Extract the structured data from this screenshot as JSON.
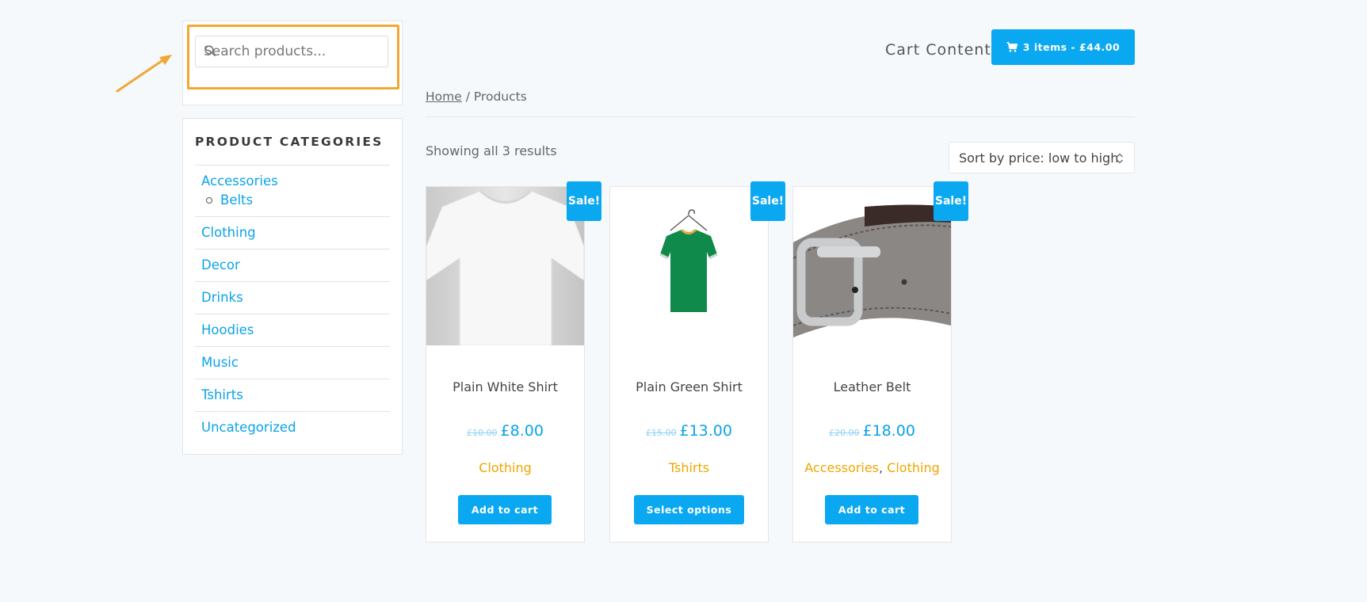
{
  "search": {
    "placeholder": "Search products..."
  },
  "sidebar": {
    "categories_title": "PRODUCT CATEGORIES",
    "categories": [
      {
        "label": "Accessories",
        "children": [
          {
            "label": "Belts"
          }
        ]
      },
      {
        "label": "Clothing"
      },
      {
        "label": "Decor"
      },
      {
        "label": "Drinks"
      },
      {
        "label": "Hoodies"
      },
      {
        "label": "Music"
      },
      {
        "label": "Tshirts"
      },
      {
        "label": "Uncategorized"
      }
    ]
  },
  "header": {
    "cart_label": "Cart Content:",
    "cart_button": "3 items - £44.00"
  },
  "breadcrumb": {
    "home": "Home",
    "separator": " / ",
    "current": "Products"
  },
  "results_text": "Showing all 3 results",
  "sort": {
    "selected": "Sort by price: low to high"
  },
  "products": [
    {
      "name": "Plain White Shirt",
      "old_price": "£10.00",
      "price": "£8.00",
      "categories": [
        "Clothing"
      ],
      "button": "Add to cart",
      "badge": "Sale!"
    },
    {
      "name": "Plain Green Shirt",
      "old_price": "£15.00",
      "price": "£13.00",
      "categories": [
        "Tshirts"
      ],
      "button": "Select options",
      "badge": "Sale!"
    },
    {
      "name": "Leather Belt",
      "old_price": "£20.00",
      "price": "£18.00",
      "categories": [
        "Accessories",
        "Clothing"
      ],
      "category_separator": ", ",
      "button": "Add to cart",
      "badge": "Sale!"
    }
  ],
  "colors": {
    "accent": "#0aa8f0",
    "link": "#0aa3e8",
    "category": "#f0a500",
    "highlight": "#f0a832"
  },
  "icons": {
    "search": "search-icon",
    "cart": "cart-icon",
    "sort": "chevron-updown-icon",
    "arrow": "annotation-arrow"
  }
}
